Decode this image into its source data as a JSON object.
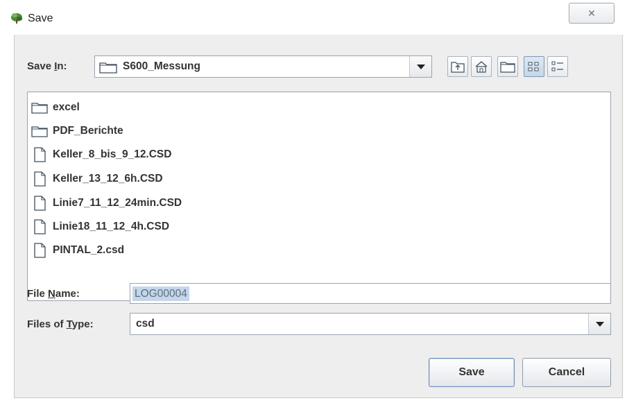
{
  "window": {
    "title": "Save",
    "close_glyph": "✕"
  },
  "save_in": {
    "label_prefix": "Save ",
    "label_mnemonic": "I",
    "label_suffix": "n:",
    "value": "S600_Messung",
    "value_icon": "folder-icon"
  },
  "toolbar": {
    "buttons": [
      {
        "name": "up-one-level",
        "icon": "up-folder-icon"
      },
      {
        "name": "home",
        "icon": "home-icon"
      },
      {
        "name": "new-folder",
        "icon": "new-folder-icon"
      },
      {
        "name": "list-view",
        "icon": "list-view-icon",
        "active": true
      },
      {
        "name": "details-view",
        "icon": "details-view-icon",
        "active": false
      }
    ]
  },
  "files": [
    {
      "name": "excel",
      "type": "folder"
    },
    {
      "name": "PDF_Berichte",
      "type": "folder"
    },
    {
      "name": "Keller_8_bis_9_12.CSD",
      "type": "file"
    },
    {
      "name": "Keller_13_12_6h.CSD",
      "type": "file"
    },
    {
      "name": "Linie7_11_12_24min.CSD",
      "type": "file"
    },
    {
      "name": "Linie18_11_12_4h.CSD",
      "type": "file"
    },
    {
      "name": "PINTAL_2.csd",
      "type": "file"
    }
  ],
  "file_name": {
    "label_prefix": "File ",
    "label_mnemonic": "N",
    "label_suffix": "ame:",
    "value": "LOG00004"
  },
  "files_of_type": {
    "label_prefix": "Files of ",
    "label_mnemonic": "T",
    "label_suffix": "ype:",
    "value": "csd"
  },
  "buttons": {
    "save": "Save",
    "cancel": "Cancel"
  }
}
